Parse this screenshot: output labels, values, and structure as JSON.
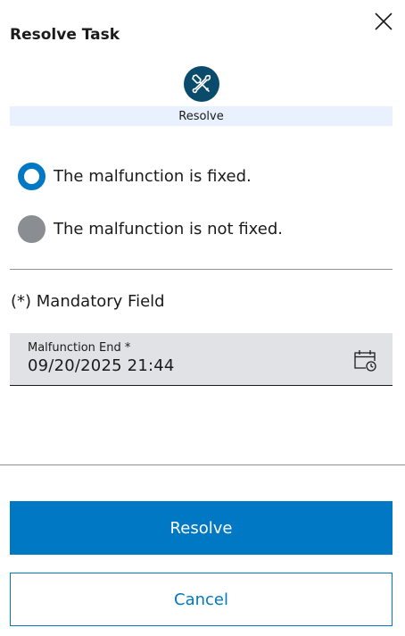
{
  "dialog": {
    "title": "Resolve Task",
    "close_icon": "close-icon"
  },
  "step": {
    "icon": "wrench-screwdriver-icon",
    "label": "Resolve",
    "icon_color": "#0a4a6b",
    "bar_color": "#e8f1fd"
  },
  "options": [
    {
      "label": "The malfunction is fixed.",
      "selected": true
    },
    {
      "label": "The malfunction is not fixed.",
      "selected": false
    }
  ],
  "form": {
    "mandatory_note": "(*) Mandatory Field",
    "malfunction_end": {
      "label": "Malfunction End *",
      "value": "09/20/2025 21:44",
      "icon": "calendar-clock-icon"
    }
  },
  "actions": {
    "primary_label": "Resolve",
    "secondary_label": "Cancel",
    "accent_color": "#0178c3"
  }
}
